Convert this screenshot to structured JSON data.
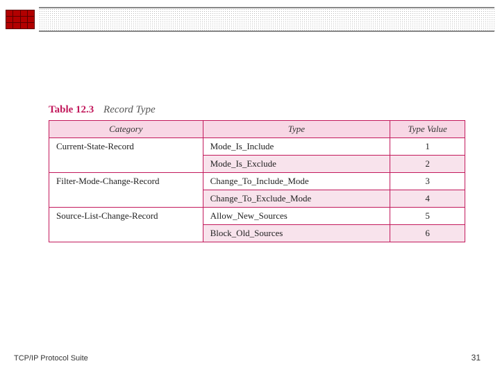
{
  "table": {
    "number": "Table 12.3",
    "caption": "Record Type",
    "headers": {
      "category": "Category",
      "type": "Type",
      "value": "Type Value"
    },
    "rows": [
      {
        "category": "Current-State-Record",
        "type": "Mode_Is_Include",
        "value": "1"
      },
      {
        "category": "",
        "type": "Mode_Is_Exclude",
        "value": "2"
      },
      {
        "category": "Filter-Mode-Change-Record",
        "type": "Change_To_Include_Mode",
        "value": "3"
      },
      {
        "category": "",
        "type": "Change_To_Exclude_Mode",
        "value": "4"
      },
      {
        "category": "Source-List-Change-Record",
        "type": "Allow_New_Sources",
        "value": "5"
      },
      {
        "category": "",
        "type": "Block_Old_Sources",
        "value": "6"
      }
    ]
  },
  "footer": {
    "left": "TCP/IP Protocol Suite",
    "right": "31"
  }
}
